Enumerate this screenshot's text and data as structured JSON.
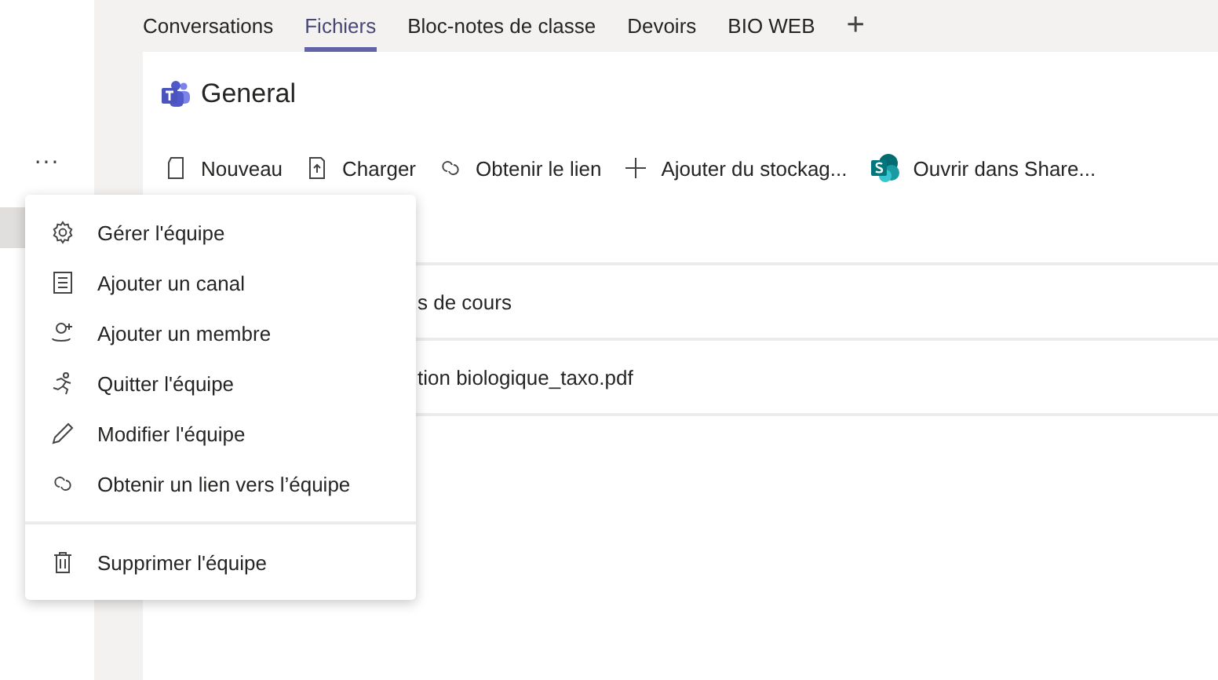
{
  "tabs": [
    {
      "label": "Conversations",
      "selected": false
    },
    {
      "label": "Fichiers",
      "selected": true
    },
    {
      "label": "Bloc-notes de classe",
      "selected": false
    },
    {
      "label": "Devoirs",
      "selected": false
    },
    {
      "label": "BIO WEB",
      "selected": false
    }
  ],
  "add_tab": "+",
  "channel": {
    "title": "General"
  },
  "toolbar": [
    {
      "kind": "new",
      "label": "Nouveau"
    },
    {
      "kind": "upload",
      "label": "Charger"
    },
    {
      "kind": "link",
      "label": "Obtenir le lien"
    },
    {
      "kind": "add",
      "label": "Ajouter du stockag..."
    },
    {
      "kind": "sharepoint",
      "label": "Ouvrir dans Share..."
    }
  ],
  "files": [
    {
      "name": "s de cours"
    },
    {
      "name": "tion biologique_taxo.pdf"
    }
  ],
  "sidebar": {
    "more": "···",
    "team_selected": true
  },
  "menu": {
    "groups": [
      [
        {
          "kind": "gear",
          "label": "Gérer l'équipe"
        },
        {
          "kind": "channel",
          "label": "Ajouter un canal"
        },
        {
          "kind": "member",
          "label": "Ajouter un membre"
        },
        {
          "kind": "leave",
          "label": "Quitter l'équipe"
        },
        {
          "kind": "edit",
          "label": "Modifier l'équipe"
        },
        {
          "kind": "link",
          "label": "Obtenir un lien vers l’équipe"
        }
      ],
      [
        {
          "kind": "delete",
          "label": "Supprimer l'équipe"
        }
      ]
    ]
  }
}
